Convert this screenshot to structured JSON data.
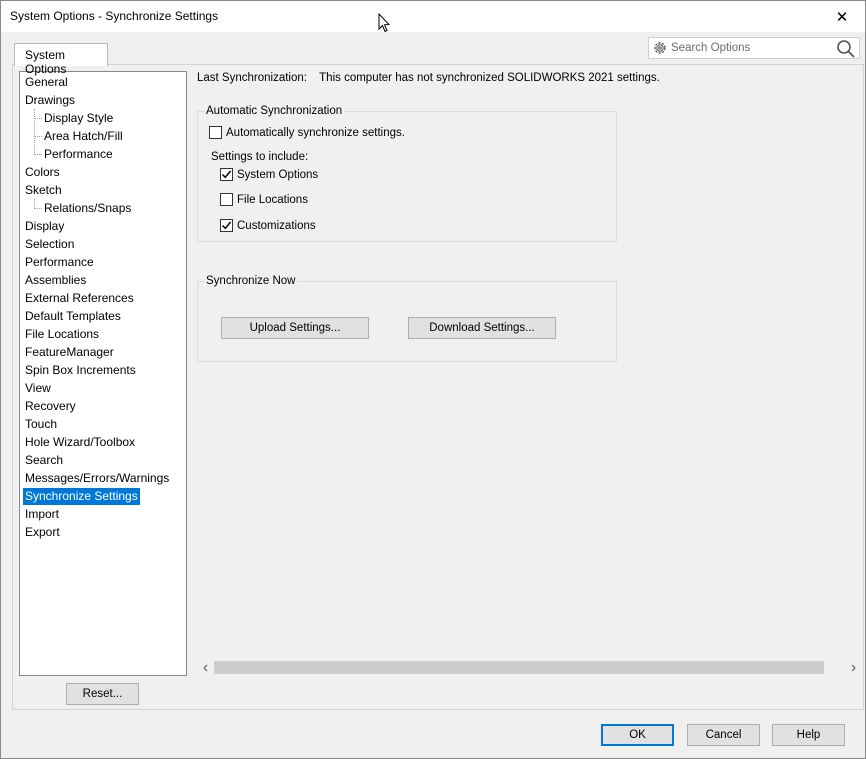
{
  "window": {
    "title": "System Options - Synchronize Settings",
    "close_glyph": "✕"
  },
  "tab": {
    "label": "System Options"
  },
  "search": {
    "placeholder": "Search Options"
  },
  "tree": {
    "items": [
      {
        "label": "General"
      },
      {
        "label": "Drawings"
      },
      {
        "label": "Display Style"
      },
      {
        "label": "Area Hatch/Fill"
      },
      {
        "label": "Performance"
      },
      {
        "label": "Colors"
      },
      {
        "label": "Sketch"
      },
      {
        "label": "Relations/Snaps"
      },
      {
        "label": "Display"
      },
      {
        "label": "Selection"
      },
      {
        "label": "Performance"
      },
      {
        "label": "Assemblies"
      },
      {
        "label": "External References"
      },
      {
        "label": "Default Templates"
      },
      {
        "label": "File Locations"
      },
      {
        "label": "FeatureManager"
      },
      {
        "label": "Spin Box Increments"
      },
      {
        "label": "View"
      },
      {
        "label": "Recovery"
      },
      {
        "label": "Touch"
      },
      {
        "label": "Hole Wizard/Toolbox"
      },
      {
        "label": "Search"
      },
      {
        "label": "Messages/Errors/Warnings"
      },
      {
        "label": "Synchronize Settings"
      },
      {
        "label": "Import"
      },
      {
        "label": "Export"
      }
    ],
    "selected": "Synchronize Settings"
  },
  "main": {
    "last_sync_label": "Last Synchronization:",
    "last_sync_value": "This computer has not synchronized SOLIDWORKS 2021 settings.",
    "auto_sync": {
      "legend": "Automatic Synchronization",
      "auto_checkbox_label": "Automatically synchronize settings.",
      "auto_checked": false,
      "include_label": "Settings to include:",
      "options": [
        {
          "label": "System Options",
          "checked": true
        },
        {
          "label": "File Locations",
          "checked": false
        },
        {
          "label": "Customizations",
          "checked": true
        }
      ]
    },
    "sync_now": {
      "legend": "Synchronize Now",
      "upload_label": "Upload Settings...",
      "download_label": "Download Settings..."
    }
  },
  "buttons": {
    "reset": "Reset...",
    "ok": "OK",
    "cancel": "Cancel",
    "help": "Help"
  },
  "scrollbar": {
    "left_arrow": "‹",
    "right_arrow": "›"
  },
  "colors": {
    "selection": "#0078d7",
    "background": "#f0f0f0"
  }
}
